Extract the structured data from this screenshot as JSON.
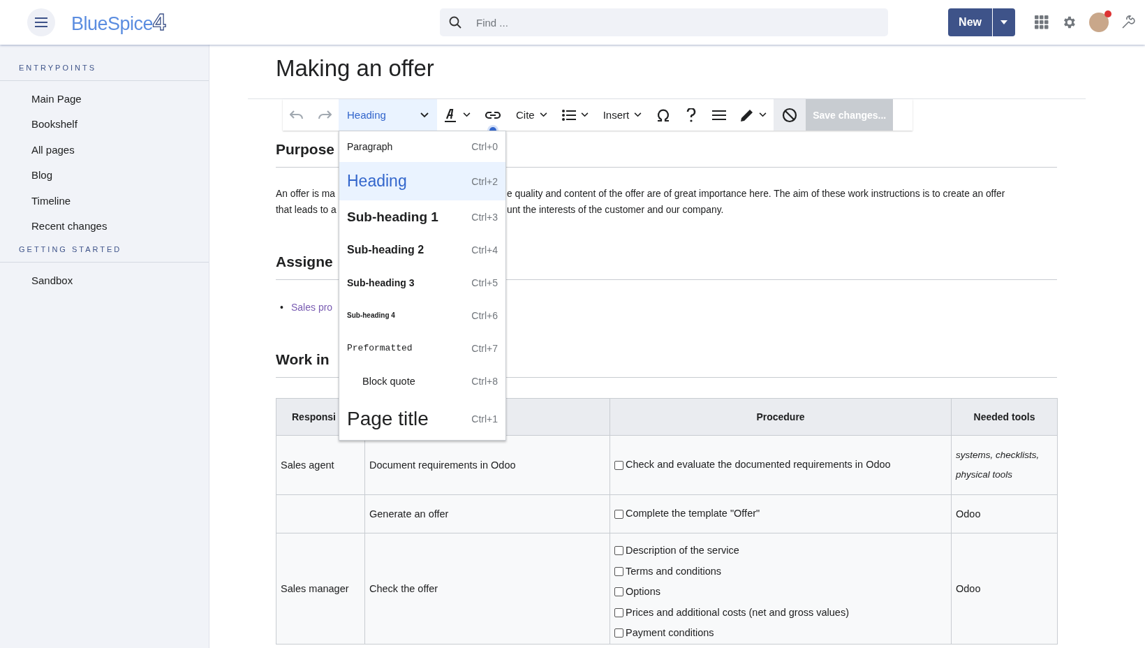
{
  "header": {
    "logo": {
      "text": "BlueSpice",
      "mark": "4"
    },
    "search": {
      "placeholder": "Find ..."
    },
    "new_button": {
      "label": "New"
    },
    "avatar": {
      "notification": true
    }
  },
  "sidebar": {
    "sections": [
      {
        "title": "ENTRYPOINTS",
        "items": [
          "Main Page",
          "Bookshelf",
          "All pages",
          "Blog",
          "Timeline",
          "Recent changes"
        ]
      },
      {
        "title": "GETTING STARTED",
        "items": [
          "Sandbox"
        ]
      }
    ]
  },
  "page": {
    "title": "Making an offer"
  },
  "toolbar": {
    "tools": [
      {
        "kind": "undo"
      },
      {
        "kind": "redo"
      },
      {
        "kind": "format",
        "label": "Heading",
        "active": true
      },
      {
        "kind": "style",
        "menu": true
      },
      {
        "kind": "link",
        "indicator": true
      },
      {
        "kind": "text",
        "label": "Cite",
        "menu": true
      },
      {
        "kind": "list",
        "menu": true
      },
      {
        "kind": "text",
        "label": "Insert",
        "menu": true
      },
      {
        "kind": "omega"
      },
      {
        "kind": "help"
      },
      {
        "kind": "options"
      },
      {
        "kind": "pencil",
        "menu": true
      },
      {
        "kind": "cancel"
      },
      {
        "kind": "save",
        "label": "Save changes...",
        "disabled": true
      }
    ]
  },
  "format_menu": {
    "open": true,
    "items": [
      {
        "kind": "paragraph",
        "label": "Paragraph",
        "shortcut": "Ctrl+0",
        "selected": false
      },
      {
        "kind": "heading",
        "label": "Heading",
        "shortcut": "Ctrl+2",
        "selected": true
      },
      {
        "kind": "subheading1",
        "label": "Sub-heading 1",
        "shortcut": "Ctrl+3",
        "selected": false
      },
      {
        "kind": "subheading2",
        "label": "Sub-heading 2",
        "shortcut": "Ctrl+4",
        "selected": false
      },
      {
        "kind": "subheading3",
        "label": "Sub-heading 3",
        "shortcut": "Ctrl+5",
        "selected": false
      },
      {
        "kind": "subheading4",
        "label": "Sub-heading 4",
        "shortcut": "Ctrl+6",
        "selected": false
      },
      {
        "kind": "preformatted",
        "label": "Preformatted",
        "shortcut": "Ctrl+7",
        "selected": false
      },
      {
        "kind": "blockquote",
        "label": "Block quote",
        "shortcut": "Ctrl+8",
        "selected": false
      },
      {
        "kind": "pagetitle",
        "label": "Page title",
        "shortcut": "Ctrl+1",
        "selected": false
      }
    ]
  },
  "content": [
    {
      "kind": "paragraph",
      "heading": "Purpose",
      "lines": [
        {
          "left": "An offer is ma",
          "right": "e quality and content of the offer are of great importance here. The aim of these work instructions is to create an offer"
        },
        {
          "left": "that leads to a",
          "right": "unt the interests of the customer and our company."
        }
      ]
    },
    {
      "kind": "list",
      "heading": "Assigne",
      "items": [
        {
          "marker": "•",
          "text": "Sales pro"
        }
      ]
    },
    {
      "kind": "table",
      "heading": "Work in",
      "columns": {
        "column_1": "Responsi",
        "column_3": "Procedure",
        "column_4": "Needed tools"
      },
      "rows": [
        {
          "role": "Sales agent",
          "task": "Document requirements in Odoo",
          "procedure": [
            {
              "text": "Check and evaluate the documented requirements in Odoo",
              "checked": false
            }
          ],
          "tools": "systems, checklists, physical tools",
          "tools_italic": true
        },
        {
          "task": "Generate an offer",
          "procedure": [
            {
              "text": "Complete the template \"Offer\"",
              "checked": false
            }
          ],
          "tools": "Odoo",
          "tools_italic": false
        },
        {
          "role": "Sales manager",
          "task": "Check the offer",
          "procedure": [
            {
              "text": "Description of the service",
              "checked": false
            },
            {
              "text": "Terms and conditions",
              "checked": false
            },
            {
              "text": "Options",
              "checked": false
            },
            {
              "text": "Prices and additional costs (net and gross values)",
              "checked": false
            },
            {
              "text": "Payment conditions",
              "checked": false
            }
          ],
          "tools": "Odoo",
          "tools_italic": false
        }
      ]
    }
  ]
}
